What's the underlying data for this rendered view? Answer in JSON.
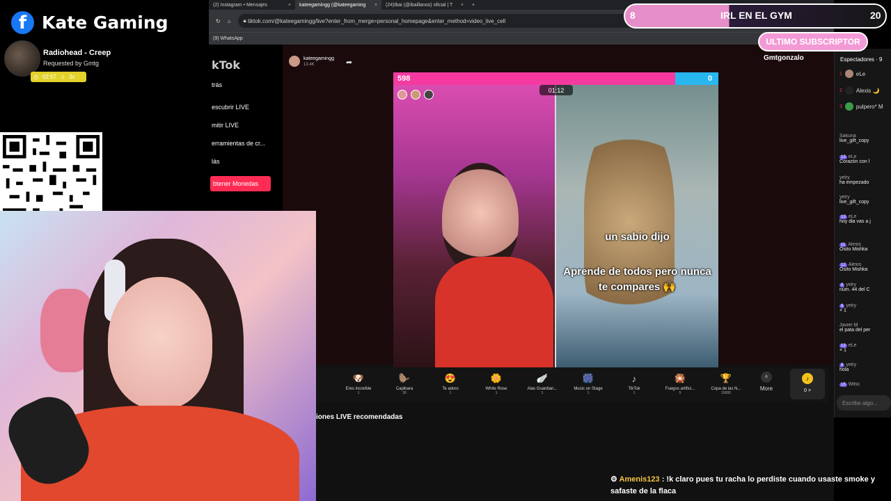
{
  "overlay": {
    "channel_name": "Kate Gaming",
    "facebook_glyph": "f",
    "song_title": "Radiohead - Creep",
    "requested_by": "Requested by Gmtg",
    "song_time": "02:57",
    "song_plays": "3x"
  },
  "browser": {
    "tabs": [
      {
        "label": "(2) Instagram • Mensajes",
        "close": "×"
      },
      {
        "label": "kateegamingg (@kateegaming",
        "close": "×"
      },
      {
        "label": "(24)Ibai (@ibaillanos) oficial | T",
        "close": "×"
      }
    ],
    "new_tab": "+",
    "url": "tiktok.com/@kateegamingg/live?enter_from_merge=personal_homepage&enter_method=video_live_cell",
    "bookmark": "(9) WhatsApp"
  },
  "tiktok": {
    "logo": "kTok",
    "sidebar": [
      "trás",
      "escubrir LIVE",
      "mitir LIVE",
      "erramientas de cr...",
      "lás"
    ],
    "get_coins": "btener Monedas",
    "host_name": "kateegamingg",
    "host_likes": "13.4K",
    "battle": {
      "left_score": "598",
      "right_score": "0",
      "timer": "01:12"
    },
    "caption_1": "un sabio dijo",
    "caption_2": "Aprende de todos pero nunca te compares",
    "caption_emoji": "🙌",
    "gifts": [
      {
        "name": "Eres increíble",
        "cost": "1",
        "icon": "🐶"
      },
      {
        "name": "Capibara",
        "cost": "30",
        "icon": "🦫"
      },
      {
        "name": "Te adoro",
        "cost": "1",
        "icon": "😍"
      },
      {
        "name": "White Rose",
        "cost": "1",
        "icon": "🌼"
      },
      {
        "name": "Alas Guardian...",
        "cost": "1",
        "icon": "🪽"
      },
      {
        "name": "Music on Stage",
        "cost": "1",
        "icon": "🎆"
      },
      {
        "name": "TikTok",
        "cost": "1",
        "icon": "♪"
      },
      {
        "name": "Fuegos artifici...",
        "cost": "5",
        "icon": "🎇"
      },
      {
        "name": "Copa de las N...",
        "cost": "15000",
        "icon": "🏆"
      }
    ],
    "more": "More",
    "coins": "0 >",
    "recommended": "iones LIVE recomendadas"
  },
  "chat": {
    "viewers_title": "Espectadores · 9",
    "viewers": [
      {
        "rank": "1",
        "name": "eLe"
      },
      {
        "rank": "2",
        "name": "Alexis 🌙"
      },
      {
        "rank": "3",
        "name": "pulpero* M"
      }
    ],
    "messages": [
      {
        "badge": "",
        "name": "Sakuna",
        "text": "live_gift_copy"
      },
      {
        "badge": "13",
        "name": "eLe",
        "text": "Corazón con l"
      },
      {
        "badge": "",
        "name": "yelry",
        "text": "ha empezado"
      },
      {
        "badge": "",
        "name": "yelry",
        "text": "live_gift_copy"
      },
      {
        "badge": "13",
        "name": "eLe",
        "text": "hoy dia vas a j"
      },
      {
        "badge": "11",
        "name": "Alexis",
        "text": "Osito Mishka"
      },
      {
        "badge": "12",
        "name": "Alexis",
        "text": "Osito Mishka"
      },
      {
        "badge": "9",
        "name": "yelry",
        "text": "núm. 44 del C"
      },
      {
        "badge": "9",
        "name": "yelry",
        "text": "× 1"
      },
      {
        "badge": "",
        "name": "Javier M",
        "text": "el pata del per"
      },
      {
        "badge": "13",
        "name": "eLe",
        "text": "× 1"
      },
      {
        "badge": "9",
        "name": "yelry",
        "text": "hola"
      },
      {
        "badge": "15",
        "name": "Wilsc",
        "text": ""
      }
    ],
    "input_placeholder": "Escribe algo..."
  },
  "goal": {
    "start": "8",
    "label": "IRL EN EL GYM",
    "end": "20",
    "progress": 0.4
  },
  "last_sub": {
    "title": "ULTIMO SUBSCRIPTOR",
    "name": "Gmtgonzalo"
  },
  "bottom_chat": {
    "user": "Amenis123",
    "message": ": !k claro pues tu racha lo perdiste cuando usaste smoke y safaste de la flaca"
  },
  "colors": {
    "tiktok_red": "#fe2c55",
    "goal_pink": "#e68ec9",
    "battle_pink": "#f43aa0",
    "battle_blue": "#28b6ef"
  }
}
